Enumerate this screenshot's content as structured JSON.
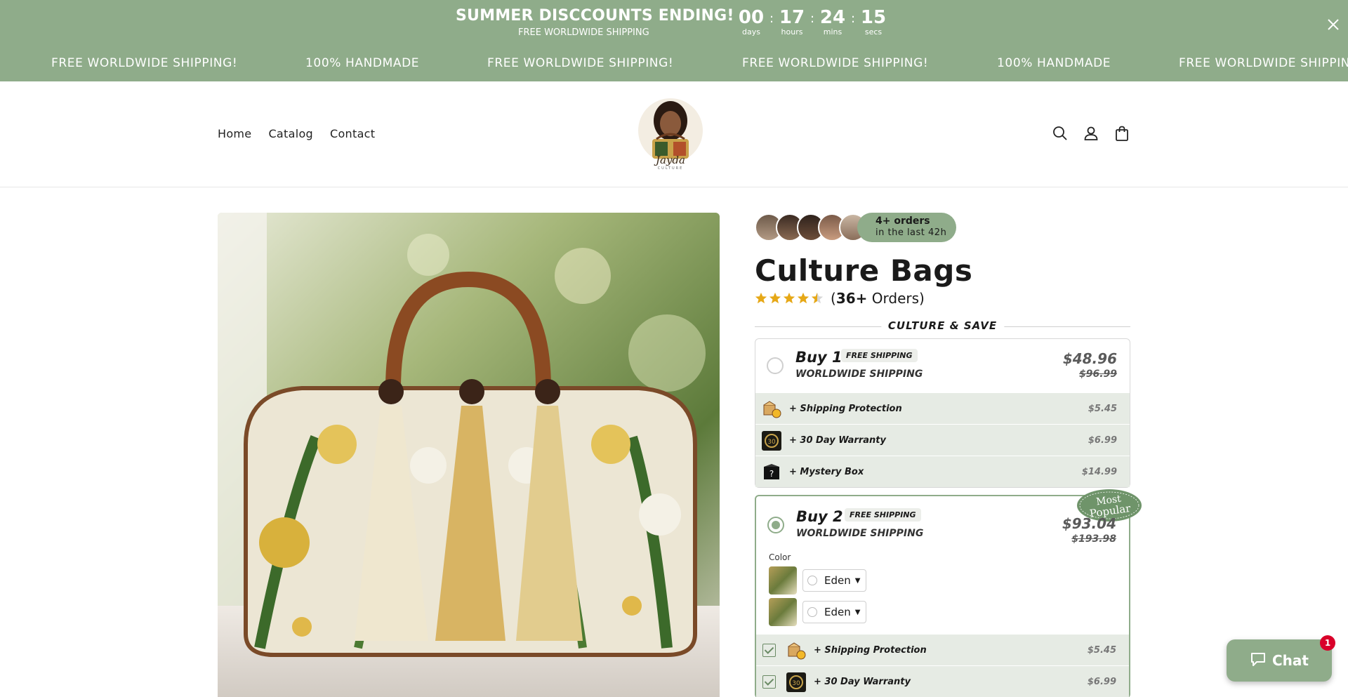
{
  "announcement": {
    "title": "SUMMER DISCCOUNTS ENDING!",
    "subtitle": "FREE WORLDWIDE SHIPPING",
    "countdown": [
      {
        "value": "00",
        "label": "days"
      },
      {
        "value": "17",
        "label": "hours"
      },
      {
        "value": "24",
        "label": "mins"
      },
      {
        "value": "15",
        "label": "secs"
      }
    ],
    "separator": ":",
    "close_icon": "close-icon",
    "marquee": [
      "FREE WORLDWIDE SHIPPING!",
      "100% HANDMADE",
      "FREE WORLDWIDE SHIPPING!",
      "FREE WORLDWIDE SHIPPING!",
      "100% HANDMADE",
      "FREE WORLDWIDE SHIPPING!"
    ]
  },
  "header": {
    "nav": [
      "Home",
      "Catalog",
      "Contact"
    ],
    "logo_text": "Jayda",
    "logo_subtext": "CULTURE",
    "icons": [
      "search-icon",
      "account-icon",
      "cart-icon"
    ]
  },
  "product": {
    "social_proof": {
      "line1": "4+ orders",
      "line2": "in the last 42h"
    },
    "title": "Culture Bags",
    "rating": 4.5,
    "orders_count": "36+",
    "orders_word": "Orders",
    "section_title": "CULTURE & SAVE",
    "bundles": [
      {
        "name": "Buy 1",
        "badge": "FREE SHIPPING",
        "shipping": "WORLDWIDE SHIPPING",
        "price": "$48.96",
        "compare_price": "$96.99",
        "addons": [
          {
            "label": "+ Shipping Protection",
            "price": "$5.45",
            "icon": "package-shield-icon"
          },
          {
            "label": "+ 30 Day Warranty",
            "price": "$6.99",
            "icon": "warranty-icon"
          },
          {
            "label": "+ Mystery Box",
            "price": "$14.99",
            "icon": "mystery-box-icon"
          }
        ]
      },
      {
        "name": "Buy 2",
        "badge": "FREE SHIPPING",
        "shipping": "WORLDWIDE SHIPPING",
        "price": "$93.04",
        "compare_price": "$193.98",
        "ribbon": {
          "line1": "Most",
          "line2": "Popular"
        },
        "color_label": "Color",
        "variants": [
          "Eden",
          "Eden"
        ],
        "addons": [
          {
            "label": "+ Shipping Protection",
            "price": "$5.45",
            "icon": "package-shield-icon"
          },
          {
            "label": "+ 30 Day Warranty",
            "price": "$6.99",
            "icon": "warranty-icon"
          }
        ]
      }
    ]
  },
  "chat": {
    "label": "Chat",
    "badge": "1"
  },
  "colors": {
    "accent": "#8fac8a",
    "star": "#e6a817",
    "badge": "#d9002a"
  }
}
